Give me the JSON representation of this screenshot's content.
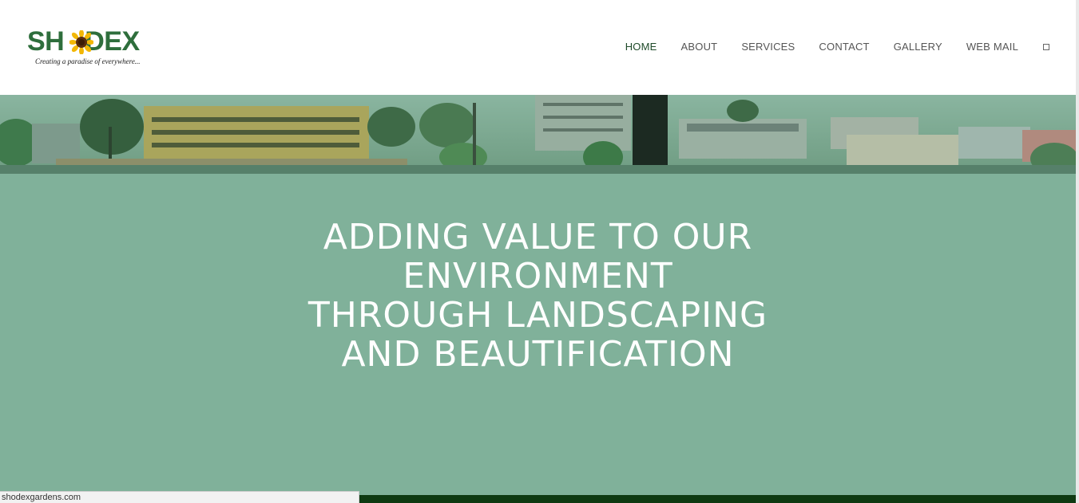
{
  "logo": {
    "text_left": "SH",
    "text_right": "DEX",
    "tagline": "Creating a paradise of everywhere..."
  },
  "nav": {
    "items": [
      {
        "label": "HOME",
        "active": true
      },
      {
        "label": "ABOUT",
        "active": false
      },
      {
        "label": "SERVICES",
        "active": false
      },
      {
        "label": "CONTACT",
        "active": false
      },
      {
        "label": "GALLERY",
        "active": false
      },
      {
        "label": "WEB MAIL",
        "active": false
      }
    ],
    "search_icon": "search-icon"
  },
  "hero": {
    "title_lines": [
      "ADDING VALUE TO OUR",
      "ENVIRONMENT",
      "THROUGH LANDSCAPING",
      "AND BEAUTIFICATION"
    ]
  },
  "status_bar": {
    "url": "shodexgardens.com"
  },
  "colors": {
    "brand_green": "#2e6e3c",
    "hero_bg": "#80b19a",
    "banner_tint": "#6f9e86",
    "footer_dark": "#0e3a12",
    "nav_text": "#555555",
    "nav_active": "#1f4b2a"
  }
}
